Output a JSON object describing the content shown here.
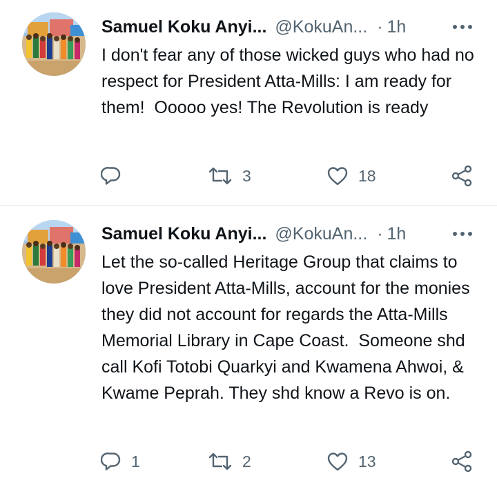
{
  "tweets": [
    {
      "author_name": "Samuel Koku Anyi...",
      "handle": "@KokuAn...",
      "separator": "·",
      "time": "1h",
      "text": "I don't fear any of those wicked guys who had no respect for President Atta-Mills: I am ready for them!  Ooooo yes! The Revolution is ready",
      "reply_count": "",
      "retweet_count": "3",
      "like_count": "18"
    },
    {
      "author_name": "Samuel Koku Anyi...",
      "handle": "@KokuAn...",
      "separator": "·",
      "time": "1h",
      "text": "Let the so-called Heritage Group that claims to love President Atta-Mills, account for the monies they did not account for regards the Atta-Mills Memorial Library in Cape Coast.  Someone shd call Kofi Totobi Quarkyi and Kwamena Ahwoi, & Kwame Peprah. They shd know a Revo is on.",
      "reply_count": "1",
      "retweet_count": "2",
      "like_count": "13"
    }
  ],
  "icons": {
    "more": "more-horizontal-icon",
    "reply": "reply-icon",
    "retweet": "retweet-icon",
    "like": "heart-icon",
    "share": "share-icon"
  },
  "colors": {
    "text": "#0f1419",
    "secondary": "#536471",
    "divider": "#e7e9ea"
  }
}
